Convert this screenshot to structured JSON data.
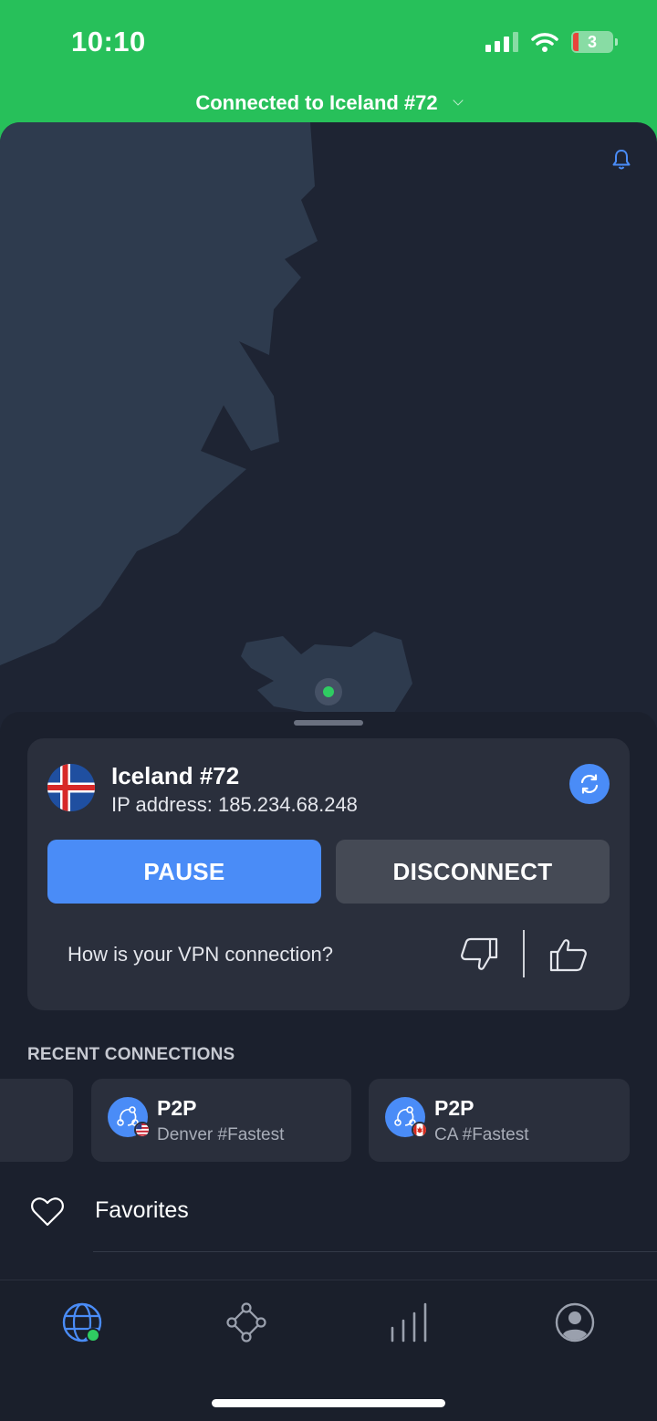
{
  "status_bar": {
    "time": "10:10",
    "battery_level": "3"
  },
  "banner": {
    "text": "Connected to Iceland #72"
  },
  "server_card": {
    "name": "Iceland #72",
    "ip_line": "IP address: 185.234.68.248",
    "pause_label": "PAUSE",
    "disconnect_label": "DISCONNECT",
    "feedback_question": "How is your VPN connection?"
  },
  "recent": {
    "title": "RECENT CONNECTIONS",
    "items": [
      {
        "name": "P2P",
        "sub": "Denver #Fastest",
        "flag": "US"
      },
      {
        "name": "P2P",
        "sub": "CA #Fastest",
        "flag": "CA"
      }
    ]
  },
  "favorites": {
    "label": "Favorites"
  },
  "colors": {
    "connected_green": "#27c05a",
    "accent_blue": "#4a8cf7",
    "background": "#1e2433",
    "card": "#2a2f3c",
    "land": "#2e3b4e"
  },
  "tabs": [
    {
      "icon": "globe-icon",
      "active": true
    },
    {
      "icon": "meshnet-icon",
      "active": false
    },
    {
      "icon": "stats-icon",
      "active": false
    },
    {
      "icon": "profile-icon",
      "active": false
    }
  ]
}
